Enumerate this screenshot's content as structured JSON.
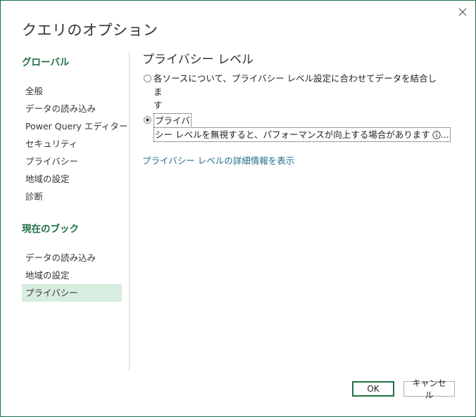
{
  "dialog": {
    "title": "クエリのオプション",
    "close_icon": "close-icon",
    "accent_color": "#1e7145"
  },
  "sidebar": {
    "global_heading": "グローバル",
    "global_items": [
      {
        "label": "全般"
      },
      {
        "label": "データの読み込み"
      },
      {
        "label": "Power Query エディター"
      },
      {
        "label": "セキュリティ"
      },
      {
        "label": "プライバシー"
      },
      {
        "label": "地域の設定"
      },
      {
        "label": "診断"
      }
    ],
    "workbook_heading": "現在のブック",
    "workbook_items": [
      {
        "label": "データの読み込み"
      },
      {
        "label": "地域の設定"
      },
      {
        "label": "プライバシー",
        "selected": true
      }
    ]
  },
  "content": {
    "title": "プライバシー レベル",
    "options": [
      {
        "line1": "各ソースについて、プライバシー レベル設定に合わせてデータを結合しま",
        "line2": "す",
        "checked": false
      },
      {
        "line1": "プライバ",
        "line2": "シー レベルを無視すると、パフォーマンスが向上する場合があります",
        "trailing": "...",
        "checked": true,
        "info_icon": "info-icon"
      }
    ],
    "link": "プライバシー レベルの詳細情報を表示"
  },
  "footer": {
    "ok_label": "OK",
    "cancel_label": "キャンセル"
  }
}
